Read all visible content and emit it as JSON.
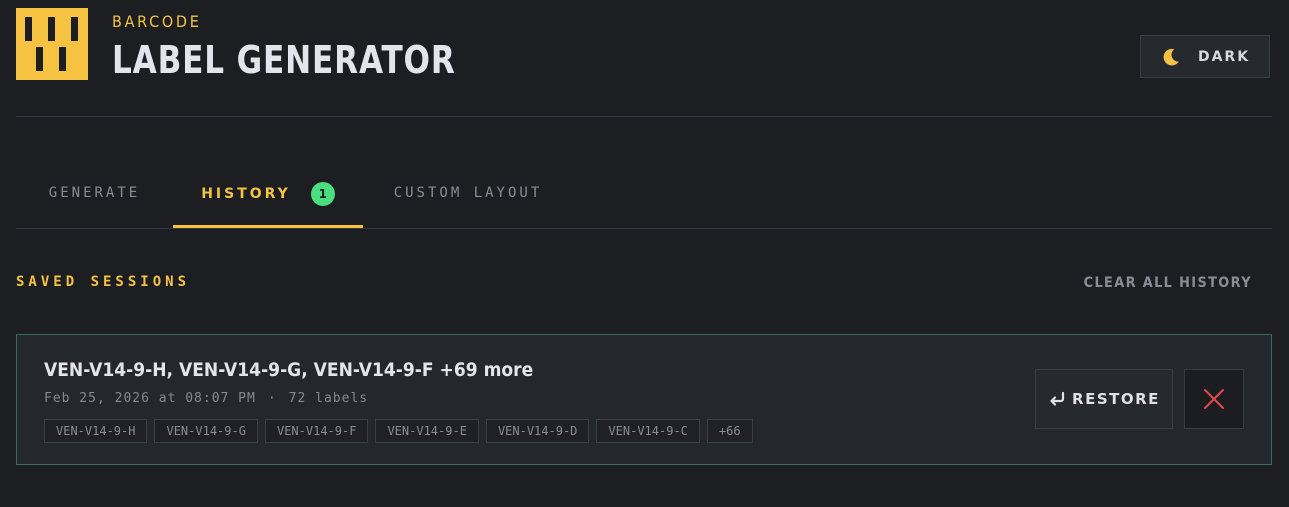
{
  "brand": {
    "subtitle": "BARCODE",
    "title": "LABEL GENERATOR"
  },
  "theme_toggle": {
    "label": "DARK",
    "icon": "moon-icon"
  },
  "tabs": [
    {
      "label": "GENERATE",
      "active": false
    },
    {
      "label": "HISTORY",
      "active": true,
      "badge": "1"
    },
    {
      "label": "CUSTOM LAYOUT",
      "active": false
    }
  ],
  "history": {
    "section_title": "SAVED SESSIONS",
    "clear_label": "CLEAR ALL HISTORY",
    "sessions": [
      {
        "title": "VEN-V14-9-H, VEN-V14-9-G, VEN-V14-9-F +69 more",
        "date": "Feb 25, 2026 at 08:07 PM",
        "separator": "·",
        "count": "72 labels",
        "chips": [
          "VEN-V14-9-H",
          "VEN-V14-9-G",
          "VEN-V14-9-F",
          "VEN-V14-9-E",
          "VEN-V14-9-D",
          "VEN-V14-9-C",
          "+66"
        ],
        "restore_label": "RESTORE"
      }
    ]
  },
  "colors": {
    "accent": "#f5c242",
    "background": "#1c1e22",
    "card": "#24272c",
    "badge": "#4ade80",
    "delete": "#e5484d",
    "card_border": "#3a6b55"
  }
}
